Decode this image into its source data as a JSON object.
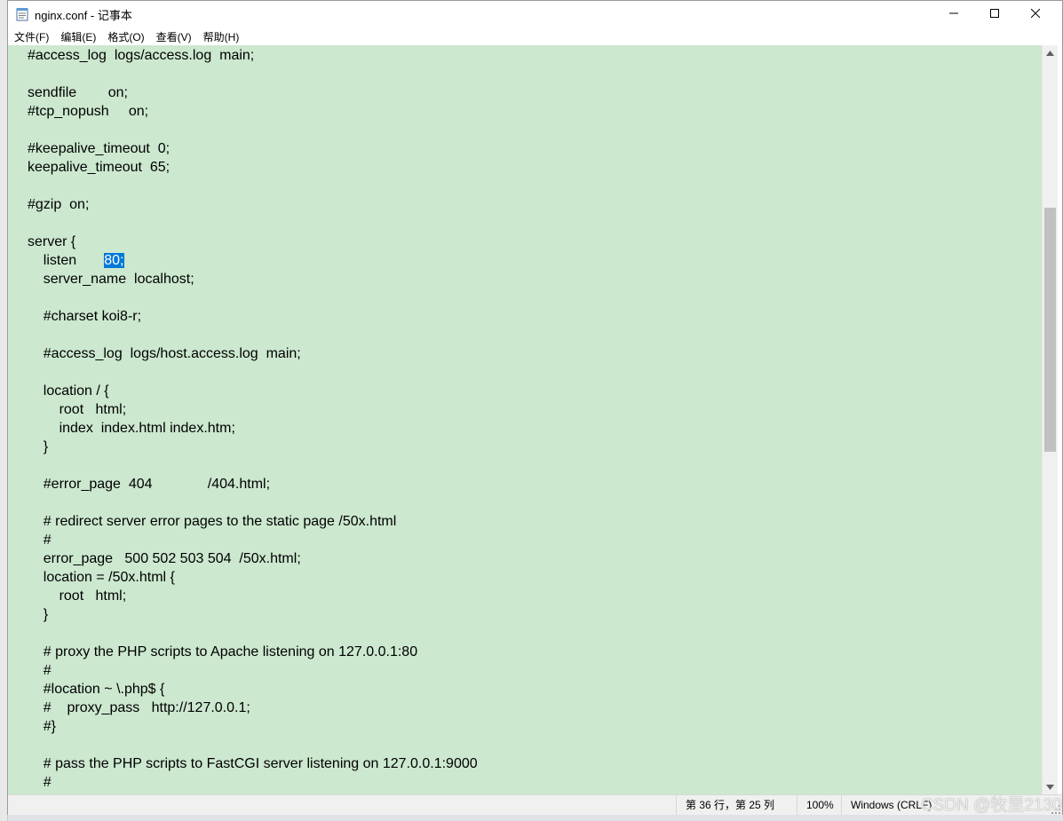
{
  "window": {
    "title": "nginx.conf - 记事本",
    "icon": "notepad-icon",
    "controls": {
      "minimize_icon": "minimize-icon",
      "maximize_icon": "maximize-icon",
      "close_icon": "close-icon"
    }
  },
  "menu": {
    "items": [
      {
        "label": "文件(F)"
      },
      {
        "label": "编辑(E)"
      },
      {
        "label": "格式(O)"
      },
      {
        "label": "查看(V)"
      },
      {
        "label": "帮助(H)"
      }
    ]
  },
  "editor": {
    "background": "#cce8cf",
    "selection_color": "#0078d7",
    "selection": {
      "line": 11,
      "before": "    listen       ",
      "text": "80;",
      "after": ""
    },
    "lines": [
      "#access_log  logs/access.log  main;",
      "",
      "sendfile        on;",
      "#tcp_nopush     on;",
      "",
      "#keepalive_timeout  0;",
      "keepalive_timeout  65;",
      "",
      "#gzip  on;",
      "",
      "server {",
      "    listen       80;",
      "    server_name  localhost;",
      "",
      "    #charset koi8-r;",
      "",
      "    #access_log  logs/host.access.log  main;",
      "",
      "    location / {",
      "        root   html;",
      "        index  index.html index.htm;",
      "    }",
      "",
      "    #error_page  404              /404.html;",
      "",
      "    # redirect server error pages to the static page /50x.html",
      "    #",
      "    error_page   500 502 503 504  /50x.html;",
      "    location = /50x.html {",
      "        root   html;",
      "    }",
      "",
      "    # proxy the PHP scripts to Apache listening on 127.0.0.1:80",
      "    #",
      "    #location ~ \\.php$ {",
      "    #    proxy_pass   http://127.0.0.1;",
      "    #}",
      "",
      "    # pass the PHP scripts to FastCGI server listening on 127.0.0.1:9000",
      "    #"
    ]
  },
  "scrollbar": {
    "up_icon": "scroll-up-arrow-icon",
    "down_icon": "scroll-down-arrow-icon"
  },
  "status": {
    "position": "第 36 行，第 25 列",
    "zoom": "100%",
    "line_ending": "Windows (CRLF)",
    "watermark": "CSDN @牧里2130"
  }
}
